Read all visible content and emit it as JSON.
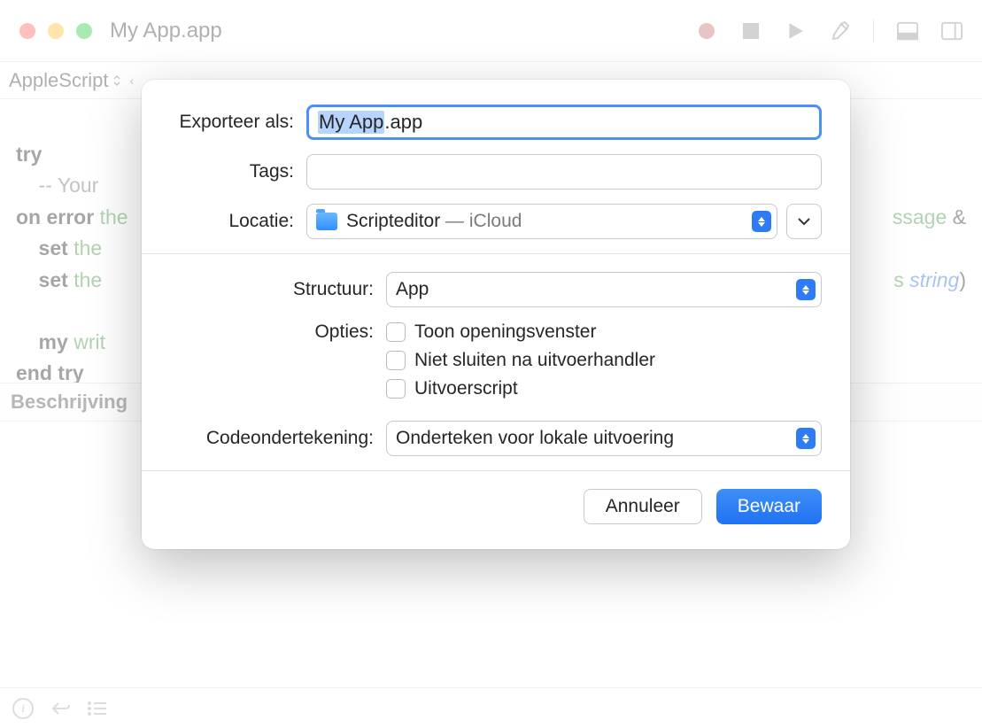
{
  "window": {
    "title": "My App.app",
    "language_picker": "AppleScript"
  },
  "code": {
    "line1": "try",
    "line2": "    -- Your",
    "line3_1": "on error",
    "line3_2": " the",
    "line4_1": "    set",
    "line4_2": " the",
    "line4_tail": "ssage",
    "line4_amp": " &",
    "line5_1": "    set",
    "line5_2": " the",
    "line5_tail_1": "s ",
    "line5_tail_2": "string",
    "line5_tail_3": ")",
    "line6_1": "    my",
    "line6_2": " writ",
    "line7": "end try"
  },
  "description_header": "Beschrijving",
  "sheet": {
    "export_label": "Exporteer als:",
    "export_value_sel": "My App",
    "export_value_rest": ".app",
    "tags_label": "Tags:",
    "tags_value": "",
    "location_label": "Locatie:",
    "location_value_main": "Scripteditor",
    "location_value_sep": " — ",
    "location_value_sub": "iCloud",
    "structure_label": "Structuur:",
    "structure_value": "App",
    "options_label": "Opties:",
    "options": {
      "show_startup": "Toon openingsvenster",
      "stay_open": "Niet sluiten na uitvoerhandler",
      "run_only": "Uitvoerscript"
    },
    "codesign_label": "Codeondertekening:",
    "codesign_value": "Onderteken voor lokale uitvoering",
    "cancel": "Annuleer",
    "save": "Bewaar"
  }
}
